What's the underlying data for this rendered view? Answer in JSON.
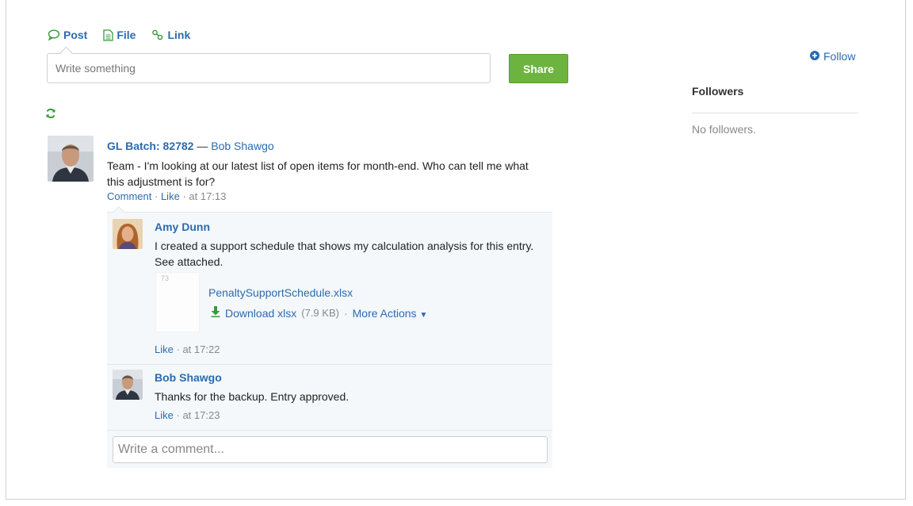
{
  "publisher": {
    "tabs": [
      {
        "label": "Post",
        "icon": "speech-bubble-icon"
      },
      {
        "label": "File",
        "icon": "document-icon"
      },
      {
        "label": "Link",
        "icon": "link-icon"
      }
    ],
    "composer_placeholder": "Write something",
    "share_label": "Share"
  },
  "post": {
    "title": "GL Batch: 82782",
    "separator": "—",
    "author": "Bob Shawgo",
    "body": "Team - I'm looking at our latest list of open items for month-end. Who can tell me what this adjustment is for?",
    "comment_label": "Comment",
    "like_label": "Like",
    "dot": "·",
    "time": "at 17:13"
  },
  "comments": [
    {
      "author": "Amy Dunn",
      "body": "I created a support schedule that shows my calculation analysis for this entry. See attached.",
      "attachment": {
        "thumb_text": "73",
        "file_name": "PenaltySupportSchedule.xlsx",
        "download_label": "Download xlsx",
        "size": "(7.9 KB)",
        "more_actions_label": "More Actions"
      },
      "like_label": "Like",
      "time": "at 17:22"
    },
    {
      "author": "Bob Shawgo",
      "body": "Thanks for the backup. Entry approved.",
      "like_label": "Like",
      "time": "at 17:23"
    }
  ],
  "comment_input_placeholder": "Write a comment...",
  "sidebar": {
    "follow_label": "Follow",
    "followers_title": "Followers",
    "no_followers": "No followers."
  },
  "colors": {
    "accent_green": "#6cb33f",
    "link_blue": "#2b6bb0"
  }
}
